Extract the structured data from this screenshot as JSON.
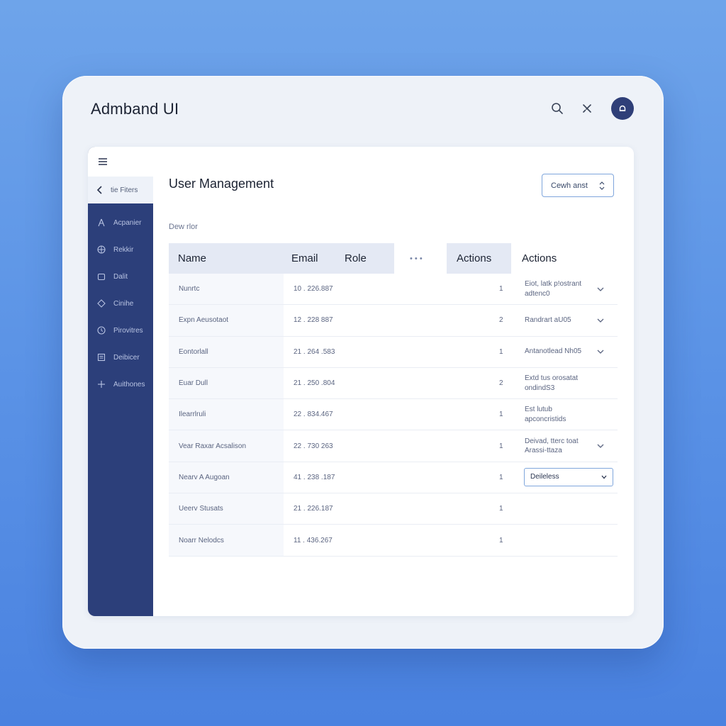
{
  "app": {
    "title": "Admband UI"
  },
  "sidebar": {
    "back_label": "tie Fiters",
    "items": [
      {
        "label": "Acpanier",
        "icon": "person-icon"
      },
      {
        "label": "Rekkir",
        "icon": "globe-icon"
      },
      {
        "label": "Dalit",
        "icon": "folder-icon"
      },
      {
        "label": "Cinihe",
        "icon": "tag-icon"
      },
      {
        "label": "Pirovitres",
        "icon": "clock-icon"
      },
      {
        "label": "Deibicer",
        "icon": "document-icon"
      },
      {
        "label": "Auithones",
        "icon": "plus-icon"
      }
    ]
  },
  "main": {
    "title": "User Management",
    "top_button_label": "Cewh anst",
    "sub_label": "Dew rlor",
    "columns": [
      "Name",
      "Email",
      "Role",
      "• • •",
      "Actions",
      "Actions"
    ],
    "rows": [
      {
        "name": "Nunrtc",
        "email": "10 . 226.887",
        "num": "1",
        "action": "Eiot, latk p!ostrant adtenc0",
        "chevron": true
      },
      {
        "name": "Expn Aeusotaot",
        "email": "12 . 228 887",
        "num": "2",
        "action": "Randrart aU05",
        "chevron": true
      },
      {
        "name": "Eontorlall",
        "email": "21 . 264 .583",
        "num": "1",
        "action": "Antanotlead Nh05",
        "chevron": true
      },
      {
        "name": "Euar Dull",
        "email": "21 . 250 .804",
        "num": "2",
        "action": "Extd tus orosatat ondindS3",
        "chevron": false
      },
      {
        "name": "Ilearrlruli",
        "email": "22 . 834.467",
        "num": "1",
        "action": "Est lutub apconcristids",
        "chevron": false
      },
      {
        "name": "Vear Raxar Acsalison",
        "email": "22 . 730 263",
        "num": "1",
        "action": "Deivad, tterc toat Arassi-ttaza",
        "chevron": true
      },
      {
        "name": "Nearv A Augoan",
        "email": "41 . 238 .187",
        "num": "1",
        "dropdown": "Deileless"
      },
      {
        "name": "Ueerv Stusats",
        "email": "21 . 226.187",
        "num": "1"
      },
      {
        "name": "Noarr Nelodcs",
        "email": "11 . 436.267",
        "num": "1"
      }
    ]
  }
}
